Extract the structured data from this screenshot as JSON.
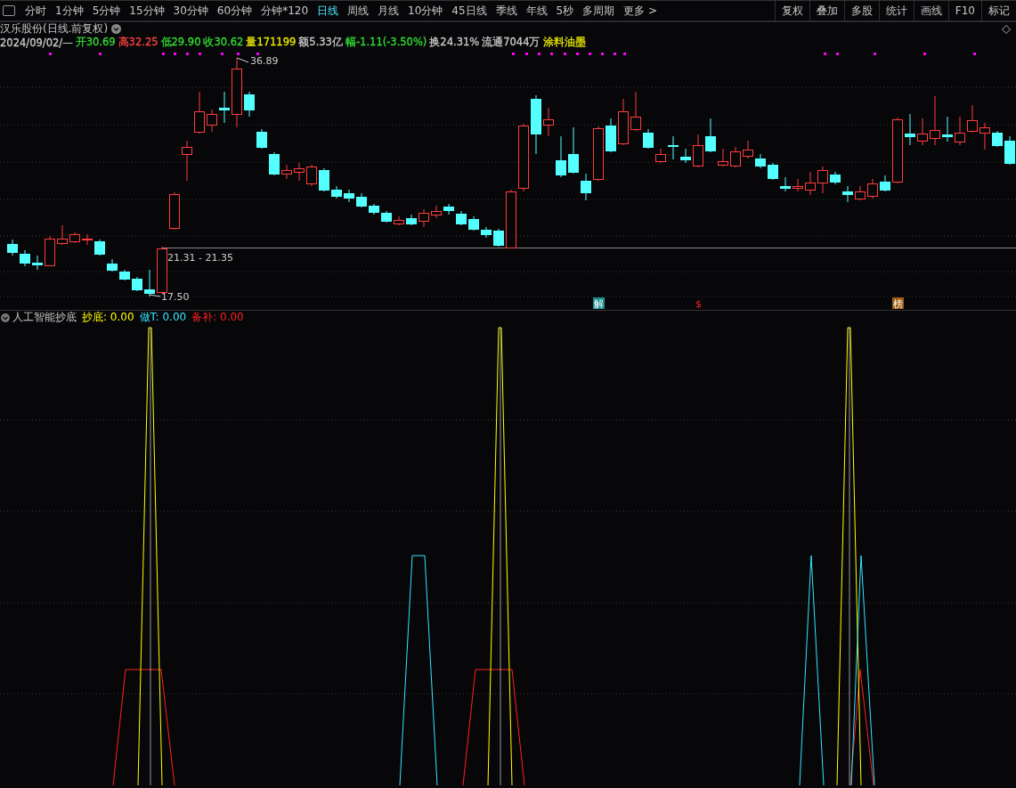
{
  "toolbar": {
    "periods": [
      {
        "label": "分时",
        "selected": false
      },
      {
        "label": "1分钟",
        "selected": false
      },
      {
        "label": "5分钟",
        "selected": false
      },
      {
        "label": "15分钟",
        "selected": false
      },
      {
        "label": "30分钟",
        "selected": false
      },
      {
        "label": "60分钟",
        "selected": false
      },
      {
        "label": "分钟*120",
        "selected": false
      },
      {
        "label": "日线",
        "selected": true
      },
      {
        "label": "周线",
        "selected": false
      },
      {
        "label": "月线",
        "selected": false
      },
      {
        "label": "10分钟",
        "selected": false
      },
      {
        "label": "45日线",
        "selected": false
      },
      {
        "label": "季线",
        "selected": false
      },
      {
        "label": "年线",
        "selected": false
      },
      {
        "label": "5秒",
        "selected": false
      },
      {
        "label": "多周期",
        "selected": false
      }
    ],
    "more": "更多 >",
    "tools": [
      "复权",
      "叠加",
      "多股",
      "统计",
      "画线",
      "F10",
      "标记"
    ]
  },
  "stock": {
    "title": "汉乐股份(日线.前复权)"
  },
  "quote": [
    {
      "text": "2024/09/02/—",
      "color": "#c8c8c8"
    },
    {
      "text": "开30.69",
      "color": "#33dd33"
    },
    {
      "text": "高32.25",
      "color": "#ff4040"
    },
    {
      "text": "低29.90",
      "color": "#33dd33"
    },
    {
      "text": "收30.62",
      "color": "#33dd33"
    },
    {
      "text": "量171199",
      "color": "#e8e800"
    },
    {
      "text": "额5.33亿",
      "color": "#c8c8c8"
    },
    {
      "text": "幅-1.11(-3.50%)",
      "color": "#33dd33"
    },
    {
      "text": "换24.31%",
      "color": "#c8c8c8"
    },
    {
      "text": "流通7044万",
      "color": "#c8c8c8"
    },
    {
      "text": "涂料油墨",
      "color": "#e8e800"
    }
  ],
  "price_chart": {
    "high_label": "36.89",
    "low_label": "17.50",
    "range_label": "21.31 - 21.35",
    "events": [
      {
        "text": "解",
        "kind": "unlock"
      },
      {
        "text": "$",
        "kind": "dividend"
      },
      {
        "text": "榜",
        "kind": "ranking"
      }
    ]
  },
  "indicator": {
    "name": "人工智能抄底",
    "lines": [
      {
        "text": "抄底: 0.00",
        "color": "#ffff00"
      },
      {
        "text": "做T: 0.00",
        "color": "#33e6ff"
      },
      {
        "text": "备补: 0.00",
        "color": "#ff2020"
      }
    ]
  }
}
